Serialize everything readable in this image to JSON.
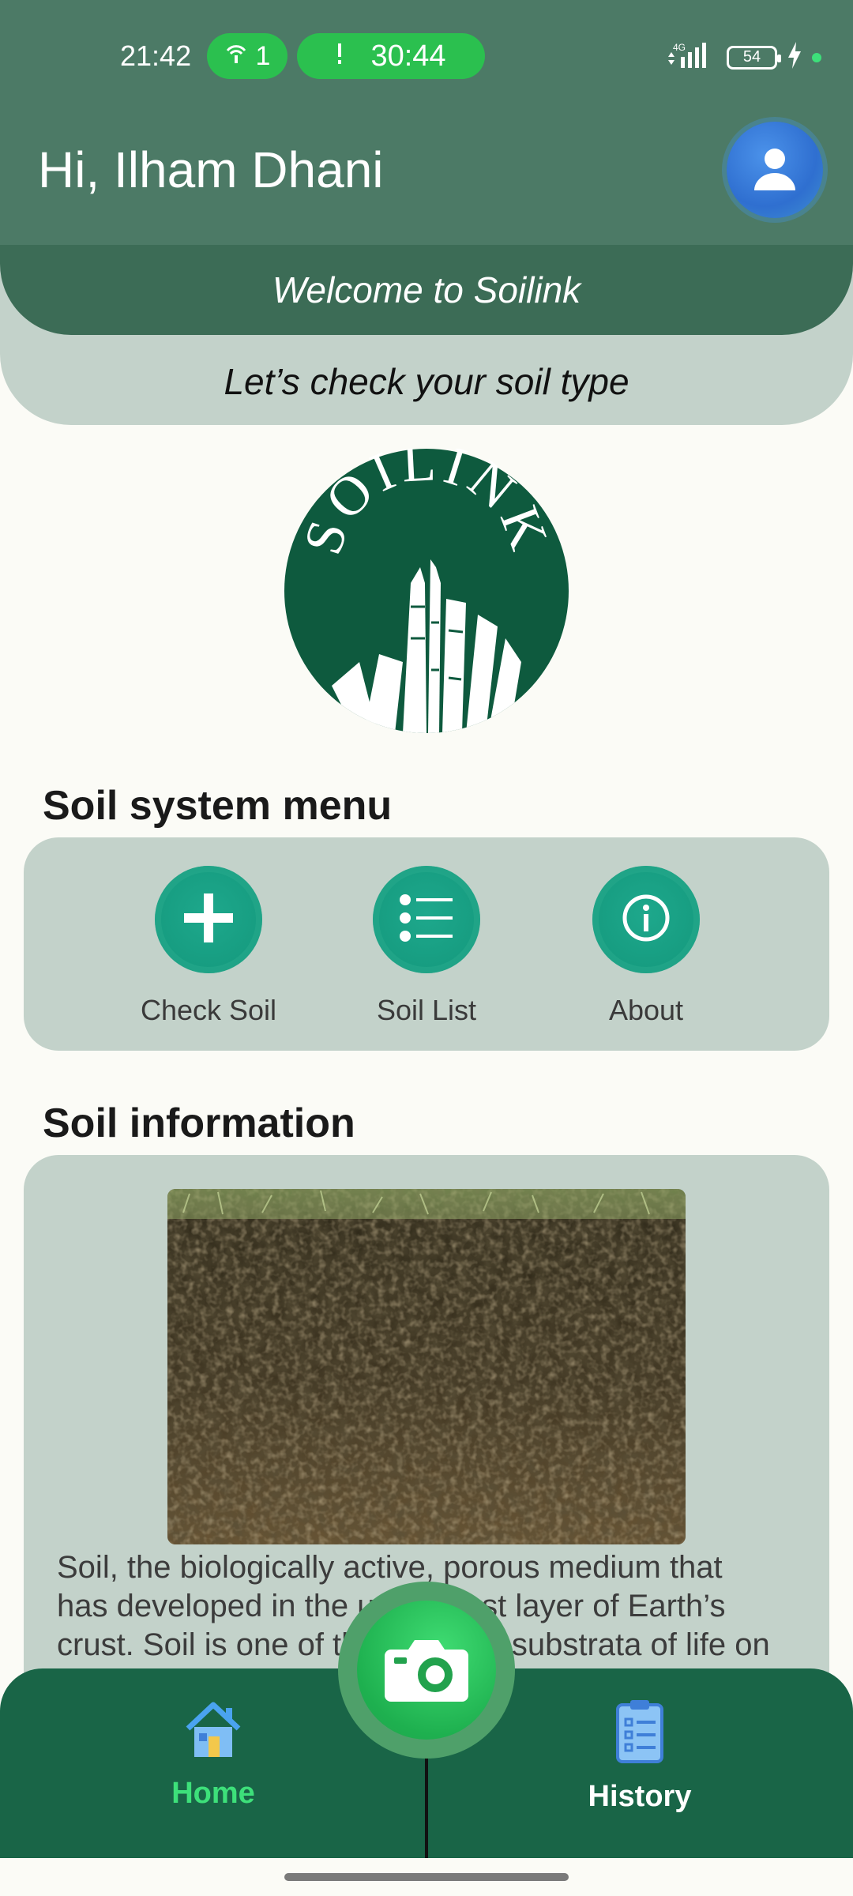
{
  "status_bar": {
    "time": "21:42",
    "hotspot_count": "1",
    "timer": "30:44",
    "network": "4G",
    "battery": "54",
    "icons": [
      "hotspot-icon",
      "alert-icon",
      "signal-icon",
      "battery-icon",
      "charging-icon"
    ]
  },
  "header": {
    "greeting": "Hi, Ilham Dhani",
    "welcome": "Welcome to Soilink",
    "subtitle": "Let’s check your soil type"
  },
  "logo": {
    "text": "SOILINK"
  },
  "menu": {
    "title": "Soil system menu",
    "items": [
      {
        "label": "Check Soil",
        "icon": "plus-icon"
      },
      {
        "label": "Soil List",
        "icon": "list-icon"
      },
      {
        "label": "About",
        "icon": "info-icon"
      }
    ]
  },
  "info": {
    "title": "Soil information",
    "image": "soil-profile-photo",
    "lines": [
      "Soil, the biologically active, porous medium that",
      "has developed in the uppermost layer of Earth’s",
      "crust. Soil is one of the principal substrata of life on"
    ]
  },
  "nav": {
    "home": "Home",
    "history": "History",
    "camera": "camera-icon",
    "colors": {
      "active": "#3de07a",
      "inactive": "#ffffff",
      "bar": "#196547"
    }
  },
  "colors": {
    "header": "#4c7a66",
    "accent_dark": "#3c6c56",
    "card": "#c3d2ca",
    "menu_button": "#169c80",
    "logo": "#0e5a3e"
  }
}
